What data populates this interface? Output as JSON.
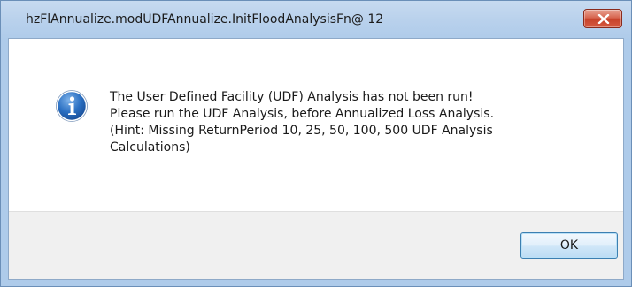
{
  "window": {
    "title": "hzFlAnnualize.modUDFAnnualize.InitFloodAnalysisFn@ 12",
    "close_icon": "close-icon"
  },
  "dialog": {
    "icon": "info-icon",
    "message_lines": [
      "The User Defined Facility (UDF) Analysis has not been run!",
      "Please run the UDF Analysis, before Annualized Loss Analysis.",
      "(Hint: Missing ReturnPeriod 10, 25, 50, 100, 500 UDF Analysis",
      "Calculations)"
    ]
  },
  "buttons": {
    "ok_label": "OK"
  },
  "colors": {
    "close_button": "#c7432b",
    "info_icon": "#2a6fc2",
    "ok_button_border": "#3c7fb1"
  }
}
